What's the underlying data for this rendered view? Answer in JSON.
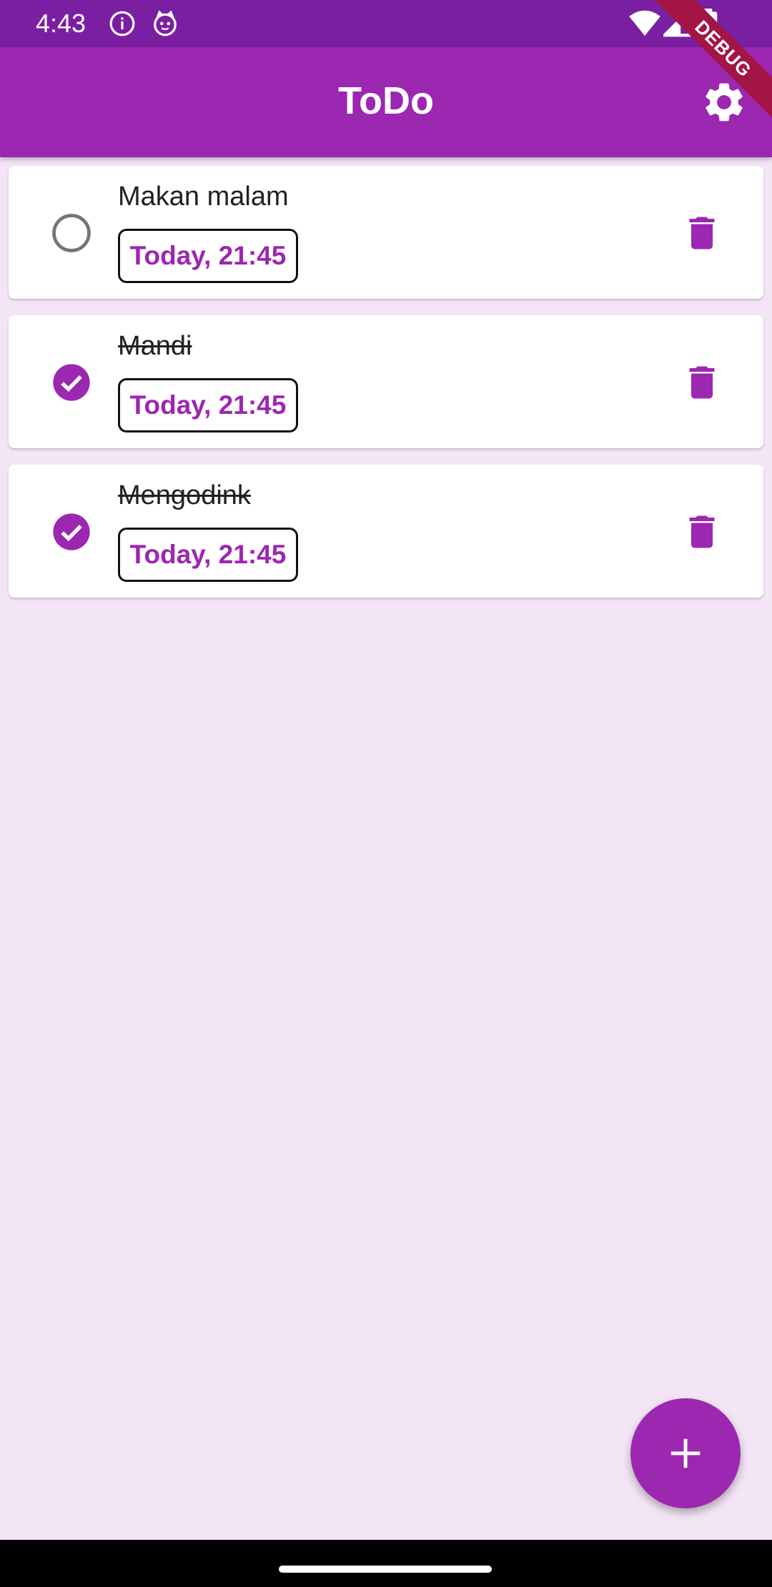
{
  "status_bar": {
    "time": "4:43",
    "icons_left": [
      "info-icon",
      "cat-icon"
    ],
    "icons_right": [
      "wifi-icon",
      "signal-icon",
      "battery-icon"
    ]
  },
  "debug_banner": "DEBUG",
  "app_bar": {
    "title": "ToDo",
    "settings_icon": "gear-icon"
  },
  "todos": [
    {
      "title": "Makan malam",
      "date": "Today, 21:45",
      "done": false
    },
    {
      "title": "Mandi",
      "date": "Today, 21:45",
      "done": true
    },
    {
      "title": "Mengodink",
      "date": "Today, 21:45",
      "done": true
    }
  ],
  "fab": {
    "icon": "plus-icon"
  },
  "colors": {
    "primary": "#9c27b0",
    "primary_dark": "#7b1fa2",
    "background": "#f3e5f5",
    "unchecked": "#757575"
  }
}
